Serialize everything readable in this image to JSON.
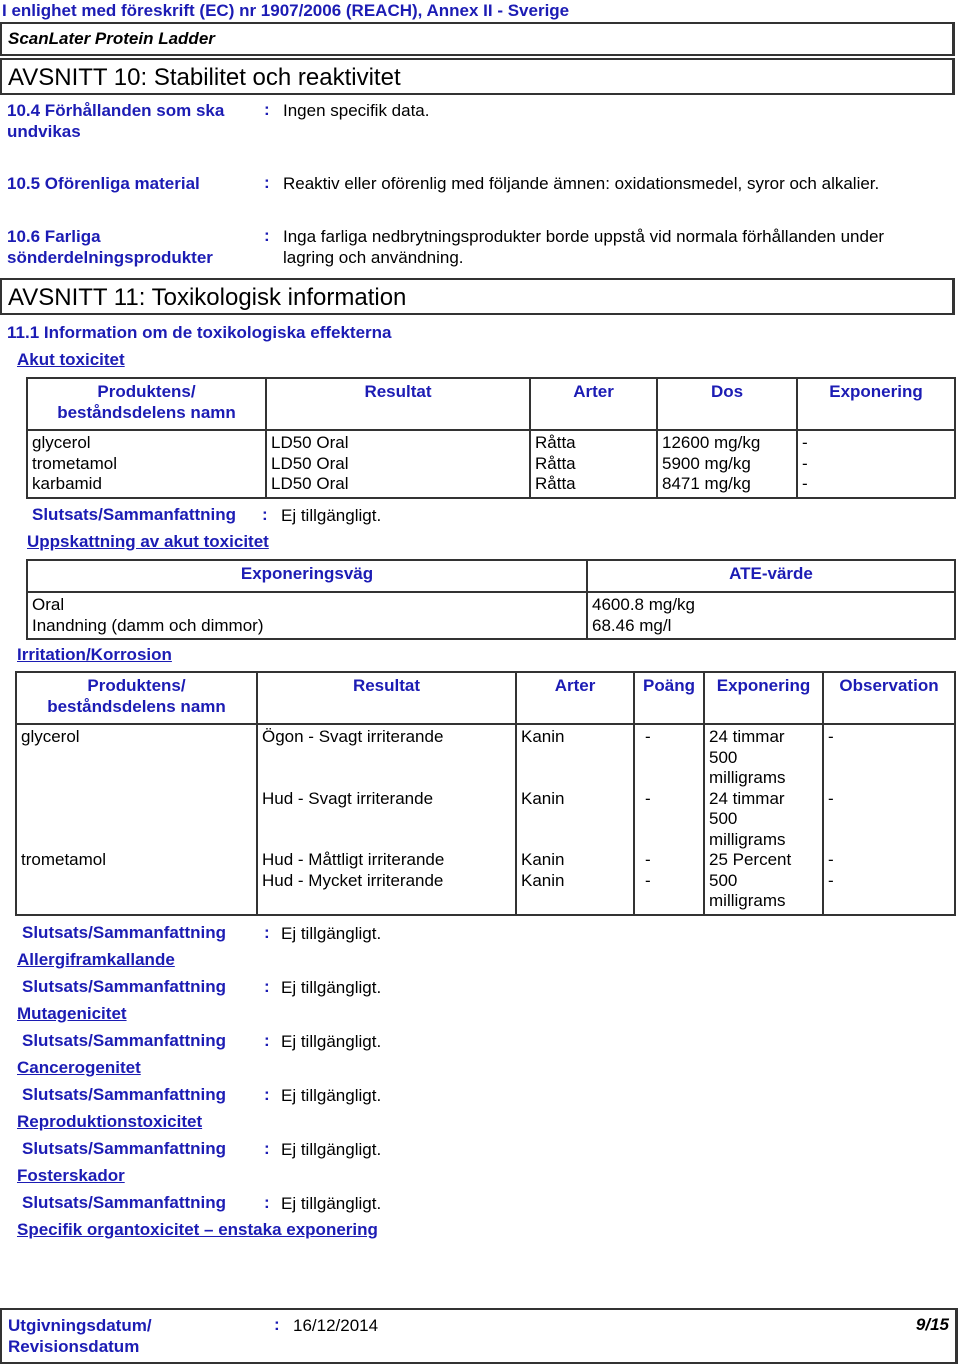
{
  "header": {
    "regulation": "I enlighet med föreskrift (EC) nr 1907/2006 (REACH), Annex II - Sverige",
    "product_name": "ScanLater Protein Ladder"
  },
  "section10": {
    "title": "AVSNITT 10: Stabilitet och reaktivitet",
    "items": [
      {
        "label_line1": "10.4 Förhållanden som ska",
        "label_line2": "undvikas",
        "value": "Ingen specifik data."
      },
      {
        "label_line1": "10.5 Oförenliga material",
        "label_line2": "",
        "value": "Reaktiv eller oförenlig med följande ämnen: oxidationsmedel, syror och alkalier."
      },
      {
        "label_line1": "10.6 Farliga",
        "label_line2": "sönderdelningsprodukter",
        "value_line1": "Inga farliga nedbrytningsprodukter borde uppstå vid normala förhållanden under",
        "value_line2": "lagring och användning."
      }
    ]
  },
  "section11": {
    "title": "AVSNITT 11: Toxikologisk information",
    "subtitle": "11.1 Information om de toxikologiska effekterna",
    "colon": ":",
    "acute": {
      "heading": "Akut toxicitet",
      "columns": [
        "Produktens/ beståndsdelens namn",
        "Resultat",
        "Arter",
        "Dos",
        "Exponering"
      ],
      "col0_line1": "Produktens/",
      "col0_line2": "beståndsdelens namn",
      "rows": [
        {
          "name": "glycerol",
          "result": "LD50 Oral",
          "species": "Råtta",
          "dose": "12600 mg/kg",
          "exposure": "-"
        },
        {
          "name": "trometamol",
          "result": "LD50 Oral",
          "species": "Råtta",
          "dose": "5900 mg/kg",
          "exposure": "-"
        },
        {
          "name": "karbamid",
          "result": "LD50 Oral",
          "species": "Råtta",
          "dose": "8471 mg/kg",
          "exposure": "-"
        }
      ],
      "conclusion_label": "Slutsats/Sammanfattning",
      "conclusion_value": "Ej tillgängligt."
    },
    "ate": {
      "heading": "Uppskattning av akut toxicitet",
      "columns": [
        "Exponeringsväg",
        "ATE-värde"
      ],
      "rows": [
        {
          "route": "Oral",
          "value": "4600.8 mg/kg"
        },
        {
          "route": "Inandning (damm och dimmor)",
          "value": "68.46 mg/l"
        }
      ]
    },
    "irritation": {
      "heading": "Irritation/Korrosion",
      "col0_line1": "Produktens/",
      "col0_line2": "beståndsdelens namn",
      "columns": [
        "Produktens/ beståndsdelens namn",
        "Resultat",
        "Arter",
        "Poäng",
        "Exponering",
        "Observation"
      ],
      "rows": [
        {
          "name": "glycerol",
          "result": "Ögon - Svagt irriterande",
          "species": "Kanin",
          "score": "-",
          "exposure_lines": [
            "24 timmar",
            "500",
            "milligrams"
          ],
          "observation": "-"
        },
        {
          "name": "",
          "result": "Hud - Svagt irriterande",
          "species": "Kanin",
          "score": "-",
          "exposure_lines": [
            "24 timmar",
            "500",
            "milligrams"
          ],
          "observation": "-"
        },
        {
          "name": "trometamol",
          "result": "Hud - Måttligt irriterande",
          "species": "Kanin",
          "score": "-",
          "exposure_lines": [
            "25 Percent"
          ],
          "observation": "-"
        },
        {
          "name": "",
          "result": "Hud - Mycket irriterande",
          "species": "Kanin",
          "score": "-",
          "exposure_lines": [
            "500",
            "milligrams"
          ],
          "observation": "-"
        }
      ],
      "conclusion_label": "Slutsats/Sammanfattning",
      "conclusion_value": "Ej tillgängligt."
    },
    "other_sections": [
      {
        "heading": "Allergiframkallande",
        "conclusion_label": "Slutsats/Sammanfattning",
        "conclusion_value": "Ej tillgängligt."
      },
      {
        "heading": "Mutagenicitet",
        "conclusion_label": "Slutsats/Sammanfattning",
        "conclusion_value": "Ej tillgängligt."
      },
      {
        "heading": "Cancerogenitet",
        "conclusion_label": "Slutsats/Sammanfattning",
        "conclusion_value": "Ej tillgängligt."
      },
      {
        "heading": "Reproduktionstoxicitet",
        "conclusion_label": "Slutsats/Sammanfattning",
        "conclusion_value": "Ej tillgängligt."
      },
      {
        "heading": "Fosterskador",
        "conclusion_label": "Slutsats/Sammanfattning",
        "conclusion_value": "Ej tillgängligt."
      }
    ],
    "last_heading": "Specifik organtoxicitet – enstaka exponering"
  },
  "footer": {
    "label_line1": "Utgivningsdatum/",
    "label_line2": "Revisionsdatum",
    "date": "16/12/2014",
    "page": "9/15"
  }
}
